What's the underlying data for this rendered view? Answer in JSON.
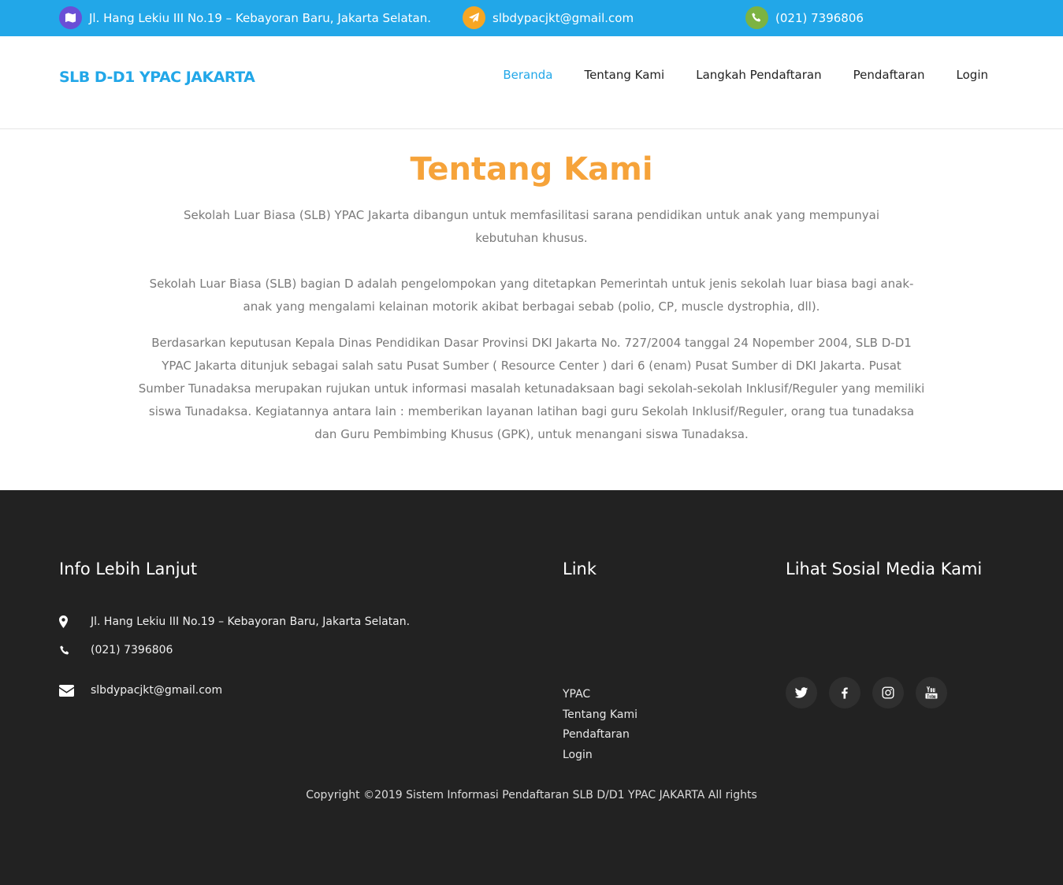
{
  "topbar": {
    "address": "Jl. Hang Lekiu III No.19 – Kebayoran Baru, Jakarta Selatan.",
    "email": "slbdypacjkt@gmail.com",
    "phone": "(021) 7396806"
  },
  "header": {
    "brand": "SLB D-D1 YPAC JAKARTA",
    "nav": [
      "Beranda",
      "Tentang Kami",
      "Langkah Pendaftaran",
      "Pendaftaran",
      "Login"
    ]
  },
  "main": {
    "title": "Tentang Kami",
    "paragraphs": [
      "Sekolah Luar Biasa (SLB) YPAC Jakarta dibangun untuk memfasilitasi sarana pendidikan untuk anak yang mempunyai kebutuhan khusus.",
      "Sekolah Luar Biasa (SLB) bagian D adalah pengelompokan yang ditetapkan Pemerintah untuk jenis sekolah luar biasa bagi anak-anak yang mengalami kelainan motorik akibat berbagai sebab (polio, CP, muscle dystrophia, dll).",
      "Berdasarkan keputusan Kepala Dinas Pendidikan Dasar Provinsi DKI Jakarta No. 727/2004 tanggal 24 Nopember 2004, SLB D-D1 YPAC Jakarta ditunjuk sebagai salah satu Pusat Sumber ( Resource Center ) dari 6 (enam) Pusat Sumber di DKI Jakarta. Pusat Sumber Tunadaksa merupakan rujukan untuk informasi masalah ketunadaksaan bagi sekolah-sekolah Inklusif/Reguler yang memiliki siswa Tunadaksa. Kegiatannya antara lain : memberikan layanan latihan bagi guru Sekolah Inklusif/Reguler, orang tua tunadaksa dan Guru Pembimbing Khusus (GPK), untuk menangani siswa Tunadaksa."
    ]
  },
  "footer": {
    "info_title": "Info Lebih Lanjut",
    "address": "Jl. Hang Lekiu III No.19 – Kebayoran Baru, Jakarta Selatan.",
    "phone": "(021) 7396806",
    "email": "slbdypacjkt@gmail.com",
    "link_title": "Link",
    "links": [
      "YPAC",
      "Tentang Kami",
      "Pendaftaran",
      "Login"
    ],
    "social_title": "Lihat Sosial Media Kami",
    "social_icons": [
      "twitter-icon",
      "facebook-icon",
      "instagram-icon",
      "youtube-icon"
    ],
    "copyright": "Copyright ©2019 Sistem Informasi Pendaftaran SLB D/D1 YPAC JAKARTA All rights"
  },
  "colors": {
    "accent_blue": "#22a7e8",
    "title_orange": "#f6a33a",
    "footer_bg": "#222222"
  }
}
